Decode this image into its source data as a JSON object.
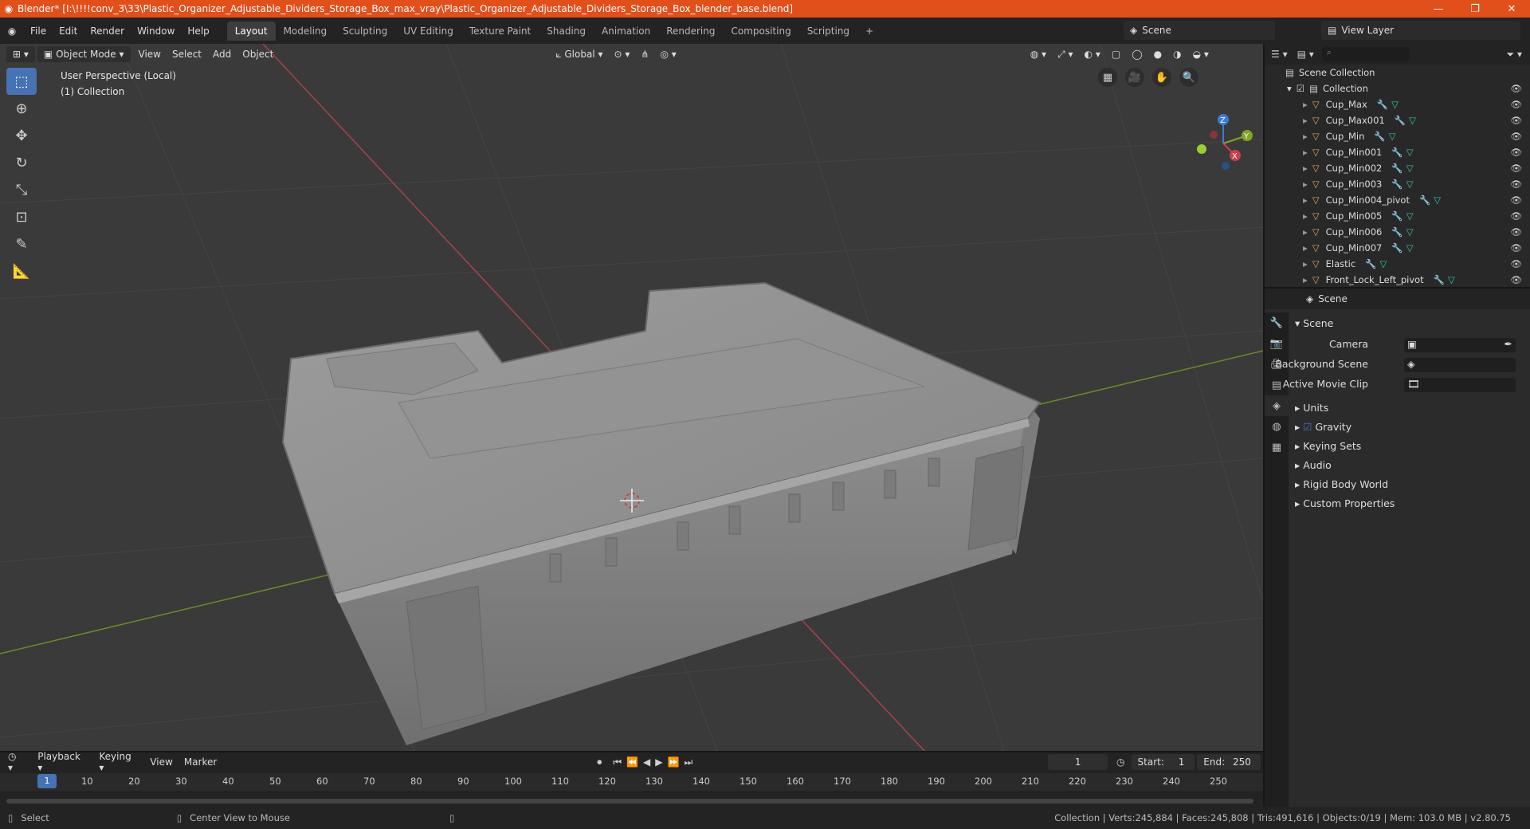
{
  "title_bar": {
    "text": "Blender* [I:\\!!!!conv_3\\33\\Plastic_Organizer_Adjustable_Dividers_Storage_Box_max_vray\\Plastic_Organizer_Adjustable_Dividers_Storage_Box_blender_base.blend]",
    "minimize": "—",
    "maximize": "❐",
    "close": "✕"
  },
  "menu": [
    "File",
    "Edit",
    "Render",
    "Window",
    "Help"
  ],
  "workspaces": [
    "Layout",
    "Modeling",
    "Sculpting",
    "UV Editing",
    "Texture Paint",
    "Shading",
    "Animation",
    "Rendering",
    "Compositing",
    "Scripting"
  ],
  "workspace_add": "+",
  "scene_selector": "Scene",
  "view_layer_selector": "View Layer",
  "viewport_header": {
    "mode": "Object Mode",
    "menus": [
      "View",
      "Select",
      "Add",
      "Object"
    ],
    "transform_orientation": "Global"
  },
  "viewport_info": {
    "line1": "User Perspective (Local)",
    "line2": "(1) Collection"
  },
  "gizmo": {
    "x": "X",
    "y": "Y",
    "z": "Z"
  },
  "outliner": {
    "scene_collection": "Scene Collection",
    "collection": "Collection",
    "objects": [
      "Cup_Max",
      "Cup_Max001",
      "Cup_Min",
      "Cup_Min001",
      "Cup_Min002",
      "Cup_Min003",
      "Cup_Min004_pivot",
      "Cup_Min005",
      "Cup_Min006",
      "Cup_Min007",
      "Elastic",
      "Front_Lock_Left_pivot"
    ]
  },
  "properties": {
    "header": "Scene",
    "panel": "Scene",
    "camera_label": "Camera",
    "background_scene_label": "Background Scene",
    "active_movie_clip_label": "Active Movie Clip",
    "sections": [
      "Units",
      "Gravity",
      "Keying Sets",
      "Audio",
      "Rigid Body World",
      "Custom Properties"
    ]
  },
  "timeline": {
    "menus": [
      "Playback",
      "Keying",
      "View",
      "Marker"
    ],
    "current_frame": "1",
    "start_label": "Start:",
    "start": "1",
    "end_label": "End:",
    "end": "250",
    "ruler": [
      "10",
      "20",
      "30",
      "40",
      "50",
      "60",
      "70",
      "80",
      "90",
      "100",
      "110",
      "120",
      "130",
      "140",
      "150",
      "160",
      "170",
      "180",
      "190",
      "200",
      "210",
      "220",
      "230",
      "240",
      "250"
    ],
    "cursor_frame": "1"
  },
  "status_bar": {
    "left": "Select",
    "middle": "Center View to Mouse",
    "right": "Collection | Verts:245,884 | Faces:245,808 | Tris:491,616 | Objects:0/19 | Mem: 103.0 MB | v2.80.75"
  },
  "colors": {
    "accent": "#4772b3",
    "title_bar": "#e14f1b",
    "x_axis": "#c9414c",
    "y_axis": "#7fa628",
    "z_axis": "#3b7ad9"
  }
}
